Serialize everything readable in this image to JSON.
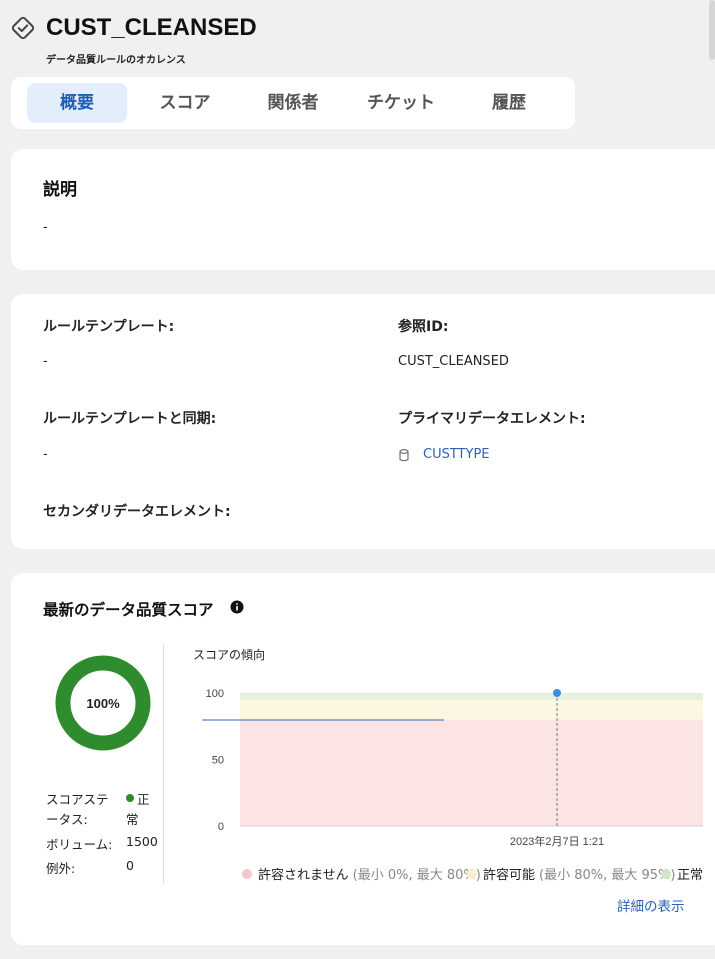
{
  "header": {
    "title": "CUST_CLEANSED",
    "subtitle": "データ品質ルールのオカレンス",
    "icon": "rule-check-icon"
  },
  "tabs": [
    {
      "label": "概要",
      "active": true
    },
    {
      "label": "スコア",
      "active": false
    },
    {
      "label": "関係者",
      "active": false
    },
    {
      "label": "チケット",
      "active": false
    },
    {
      "label": "履歴",
      "active": false
    }
  ],
  "description": {
    "title": "説明",
    "value": "-"
  },
  "details": {
    "rule_template_label": "ルールテンプレート:",
    "rule_template_value": "-",
    "reference_id_label": "参照ID:",
    "reference_id_value": "CUST_CLEANSED",
    "sync_label": "ルールテンプレートと同期:",
    "sync_value": "-",
    "primary_label": "プライマリデータエレメント:",
    "primary_value": "CUSTTYPE",
    "primary_icon": "database-icon",
    "secondary_label": "セカンダリデータエレメント:"
  },
  "score": {
    "title": "最新のデータ品質スコア",
    "info_icon": "info-icon",
    "donut_label": "100%",
    "donut_value": 100,
    "donut_color": "#2e8b2e",
    "status_label_1": "スコアステ",
    "status_label_2": "ータス:",
    "status_value_1": "正",
    "status_value_2": "常",
    "volume_label": "ボリューム:",
    "volume_value": "1500",
    "exceptions_label": "例外:",
    "exceptions_value": "0",
    "trend_title": "スコアの傾向",
    "show_details": "詳細の表示"
  },
  "chart_data": {
    "type": "line",
    "title": "スコアの傾向",
    "y_ticks": [
      "100",
      "50",
      "0"
    ],
    "ylim": [
      0,
      100
    ],
    "x_tick": "2023年2月7日 1:21",
    "series": [
      {
        "x": [
          "2023年2月7日 1:21"
        ],
        "values": [
          100
        ]
      }
    ],
    "bands": [
      {
        "label": "許容されません",
        "range": "(最小 0%, 最大 80%)",
        "min": 0,
        "max": 80,
        "color": "#fde4e4",
        "dot": "#f7c6cc"
      },
      {
        "label": "許容可能",
        "range": "(最小 80%, 最大 95%)",
        "min": 80,
        "max": 95,
        "color": "#fdf6e1",
        "dot": "#fbefcf"
      },
      {
        "label": "正常",
        "range": "",
        "min": 95,
        "max": 100,
        "color": "#e3f1de",
        "dot": "#cfe6c9"
      }
    ],
    "point_color": "#3b8de8"
  }
}
